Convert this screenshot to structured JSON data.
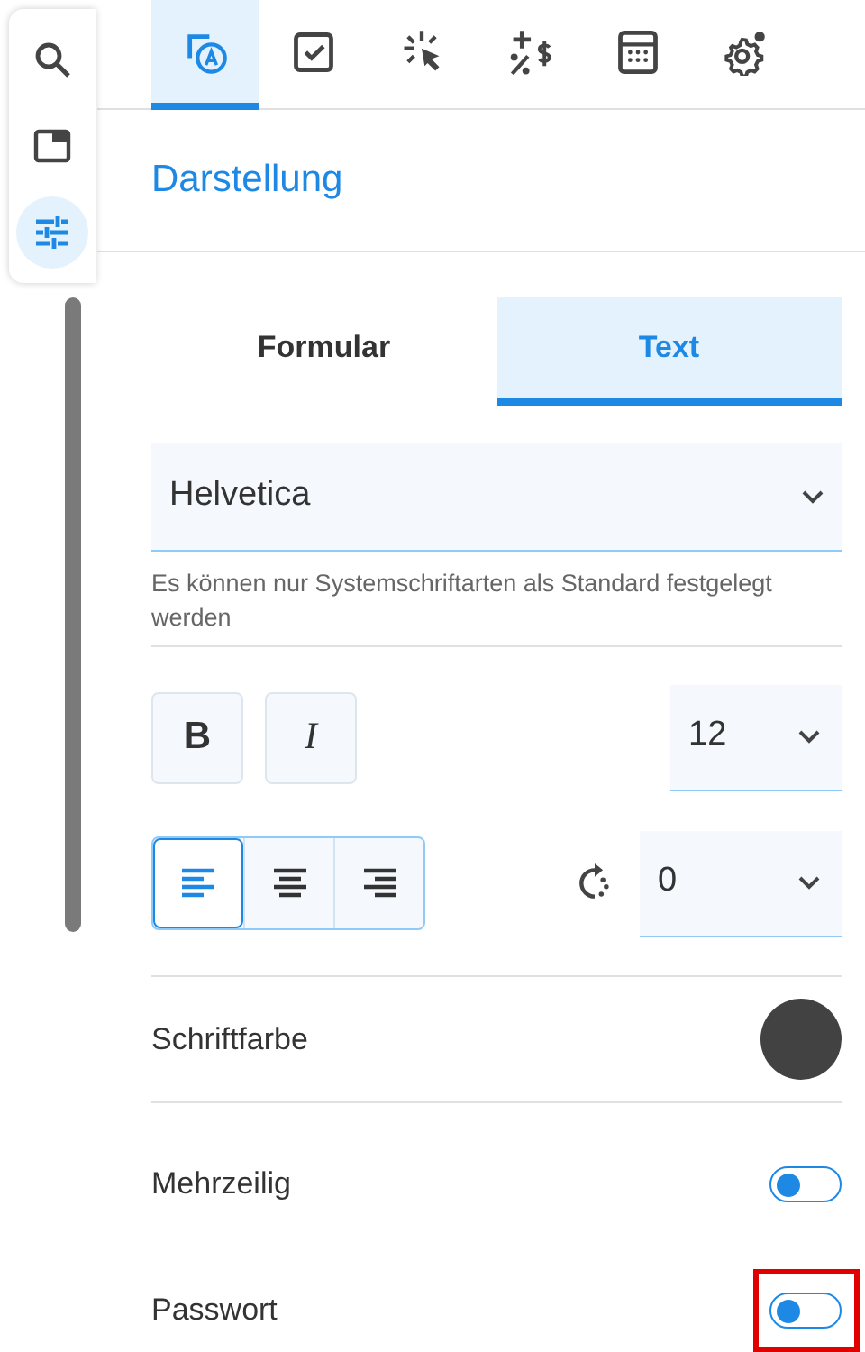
{
  "rail": [
    {
      "kind": "search",
      "selected": false
    },
    {
      "kind": "window",
      "selected": false
    },
    {
      "kind": "sliders",
      "selected": true
    }
  ],
  "tabs": [
    {
      "kind": "text-style",
      "selected": true
    },
    {
      "kind": "checkbox",
      "selected": false
    },
    {
      "kind": "click",
      "selected": false
    },
    {
      "kind": "calc",
      "selected": false
    },
    {
      "kind": "calculator",
      "selected": false
    },
    {
      "kind": "gears",
      "selected": false
    }
  ],
  "section_title": "Darstellung",
  "segments": [
    {
      "label": "Formular",
      "selected": false
    },
    {
      "label": "Text",
      "selected": true
    }
  ],
  "font_select": {
    "value": "Helvetica",
    "hint": "Es können nur Systemschriftarten als Standard festgelegt werden"
  },
  "style_buttons": [
    {
      "label": "B",
      "kind": "bold",
      "selected": false
    },
    {
      "label": "I",
      "kind": "italic",
      "selected": false
    }
  ],
  "size_select": {
    "value": "12"
  },
  "align_buttons": [
    {
      "kind": "left",
      "selected": true
    },
    {
      "kind": "center",
      "selected": false
    },
    {
      "kind": "right",
      "selected": false
    }
  ],
  "rotation_select": {
    "value": "0"
  },
  "font_color": {
    "label": "Schriftfarbe",
    "color": "#424242"
  },
  "toggles": [
    {
      "label": "Mehrzeilig",
      "checked": false,
      "highlighted": false
    },
    {
      "label": "Passwort",
      "checked": false,
      "highlighted": true
    }
  ]
}
